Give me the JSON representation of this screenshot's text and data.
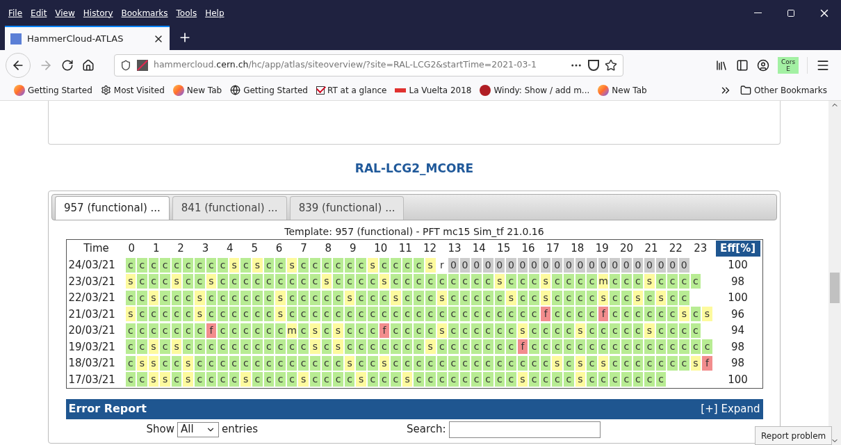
{
  "menu": [
    "File",
    "Edit",
    "View",
    "History",
    "Bookmarks",
    "Tools",
    "Help"
  ],
  "tab": {
    "title": "HammerCloud-ATLAS"
  },
  "url": {
    "host_pre": "hammercloud.",
    "host": "cern.ch",
    "path": "/hc/app/atlas/siteoverview/?site=RAL-LCG2&startTime=2021-03-1"
  },
  "toolbar_badge": {
    "top": "Cors",
    "bottom": "E"
  },
  "bookmarks": [
    {
      "label": "Getting Started",
      "kind": "firefox"
    },
    {
      "label": "Most Visited",
      "kind": "gear"
    },
    {
      "label": "New Tab",
      "kind": "firefox"
    },
    {
      "label": "Getting Started",
      "kind": "globe"
    },
    {
      "label": "RT at a glance",
      "kind": "check"
    },
    {
      "label": "La Vuelta 2018",
      "kind": "flag"
    },
    {
      "label": "Windy: Show / add m...",
      "kind": "windy"
    },
    {
      "label": "New Tab",
      "kind": "firefox"
    }
  ],
  "other_bookmarks": "Other Bookmarks",
  "site_title": "RAL-LCG2_MCORE",
  "test_tabs": [
    {
      "label": "957 (functional) ...",
      "selected": true
    },
    {
      "label": "841 (functional) ...",
      "selected": false
    },
    {
      "label": "839 (functional) ...",
      "selected": false
    }
  ],
  "template": "Template: 957 (functional) - PFT mc15 Sim_tf 21.0.16",
  "table": {
    "time_header": "Time",
    "hours": [
      "0",
      "1",
      "2",
      "3",
      "4",
      "5",
      "6",
      "7",
      "8",
      "9",
      "10",
      "11",
      "12",
      "13",
      "14",
      "15",
      "16",
      "17",
      "18",
      "19",
      "20",
      "21",
      "22",
      "23"
    ],
    "eff_header": "Eff[%]",
    "rows": [
      {
        "date": "24/03/21",
        "cells": [
          "c",
          "c",
          "c",
          "c",
          "c",
          "c",
          "c",
          "c",
          "c",
          "s",
          "c",
          "s",
          "c",
          "c",
          "s",
          "c",
          "c",
          "c",
          "c",
          "c",
          "c",
          "s",
          "c",
          "c",
          "c",
          "c",
          "s",
          "r",
          "0",
          "0",
          "0",
          "0",
          "0",
          "0",
          "0",
          "0",
          "0",
          "0",
          "0",
          "0",
          "0",
          "0",
          "0",
          "0",
          "0",
          "0",
          "0",
          "0",
          "0"
        ],
        "eff": "100"
      },
      {
        "date": "23/03/21",
        "cells": [
          "s",
          "c",
          "c",
          "c",
          "s",
          "c",
          "c",
          "s",
          "c",
          "c",
          "c",
          "c",
          "c",
          "c",
          "c",
          "c",
          "c",
          "s",
          "c",
          "c",
          "c",
          "c",
          "s",
          "c",
          "c",
          "c",
          "c",
          "c",
          "c",
          "c",
          "c",
          "c",
          "s",
          "c",
          "c",
          "c",
          "s",
          "c",
          "c",
          "c",
          "c",
          "m",
          "c",
          "c",
          "c",
          "s",
          "c",
          "c",
          "c",
          "c"
        ],
        "eff": "98"
      },
      {
        "date": "22/03/21",
        "cells": [
          "c",
          "c",
          "s",
          "c",
          "c",
          "c",
          "s",
          "c",
          "c",
          "c",
          "c",
          "c",
          "c",
          "s",
          "c",
          "c",
          "c",
          "c",
          "c",
          "s",
          "c",
          "c",
          "c",
          "s",
          "c",
          "c",
          "c",
          "s",
          "c",
          "c",
          "c",
          "c",
          "c",
          "s",
          "c",
          "c",
          "s",
          "c",
          "c",
          "c",
          "c",
          "s",
          "c",
          "c",
          "s",
          "c",
          "s",
          "c",
          "c"
        ],
        "eff": "100"
      },
      {
        "date": "21/03/21",
        "cells": [
          "s",
          "c",
          "c",
          "c",
          "c",
          "c",
          "s",
          "c",
          "c",
          "c",
          "c",
          "c",
          "c",
          "s",
          "c",
          "c",
          "c",
          "c",
          "c",
          "c",
          "c",
          "c",
          "c",
          "c",
          "c",
          "c",
          "c",
          "c",
          "c",
          "c",
          "c",
          "c",
          "c",
          "c",
          "c",
          "c",
          "f",
          "c",
          "c",
          "c",
          "c",
          "f",
          "c",
          "c",
          "c",
          "c",
          "c",
          "c",
          "s",
          "c",
          "s"
        ],
        "eff": "96"
      },
      {
        "date": "20/03/21",
        "cells": [
          "c",
          "c",
          "c",
          "c",
          "c",
          "c",
          "c",
          "f",
          "c",
          "c",
          "c",
          "c",
          "c",
          "c",
          "m",
          "c",
          "s",
          "c",
          "s",
          "c",
          "c",
          "c",
          "f",
          "c",
          "c",
          "c",
          "c",
          "s",
          "c",
          "c",
          "c",
          "c",
          "c",
          "c",
          "s",
          "c",
          "c",
          "c",
          "c",
          "s",
          "c",
          "c",
          "c",
          "c",
          "c",
          "s",
          "c",
          "c",
          "c",
          "c"
        ],
        "eff": "94"
      },
      {
        "date": "19/03/21",
        "cells": [
          "c",
          "c",
          "s",
          "c",
          "s",
          "c",
          "c",
          "c",
          "c",
          "c",
          "c",
          "c",
          "c",
          "c",
          "c",
          "c",
          "s",
          "c",
          "s",
          "c",
          "c",
          "c",
          "c",
          "c",
          "c",
          "c",
          "s",
          "c",
          "c",
          "c",
          "c",
          "c",
          "c",
          "c",
          "f",
          "c",
          "c",
          "c",
          "c",
          "c",
          "c",
          "c",
          "c",
          "c",
          "c",
          "c",
          "c",
          "c",
          "c",
          "c",
          "c"
        ],
        "eff": "98"
      },
      {
        "date": "18/03/21",
        "cells": [
          "c",
          "s",
          "s",
          "c",
          "c",
          "s",
          "c",
          "c",
          "c",
          "c",
          "c",
          "c",
          "c",
          "c",
          "c",
          "c",
          "c",
          "c",
          "c",
          "s",
          "c",
          "c",
          "s",
          "c",
          "c",
          "c",
          "c",
          "c",
          "c",
          "c",
          "c",
          "c",
          "c",
          "c",
          "c",
          "c",
          "c",
          "s",
          "c",
          "s",
          "c",
          "s",
          "c",
          "c",
          "c",
          "c",
          "c",
          "c",
          "c",
          "s",
          "f"
        ],
        "eff": "98"
      },
      {
        "date": "17/03/21",
        "cells": [
          "c",
          "c",
          "s",
          "s",
          "c",
          "s",
          "c",
          "c",
          "c",
          "c",
          "s",
          "c",
          "c",
          "c",
          "c",
          "s",
          "c",
          "c",
          "c",
          "c",
          "s",
          "c",
          "c",
          "c",
          "s",
          "c",
          "c",
          "c",
          "c",
          "c",
          "c",
          "c",
          "c",
          "c",
          "s",
          "c",
          "c",
          "c",
          "c",
          "s",
          "c",
          "c",
          "c",
          "c",
          "c",
          "c",
          "c"
        ],
        "eff": "100"
      }
    ]
  },
  "error_report": {
    "title": "Error Report",
    "expand": "[+] Expand"
  },
  "show": {
    "label": "Show",
    "value": "All",
    "suffix": "entries"
  },
  "search": {
    "label": "Search:"
  },
  "report_button": "Report problem"
}
